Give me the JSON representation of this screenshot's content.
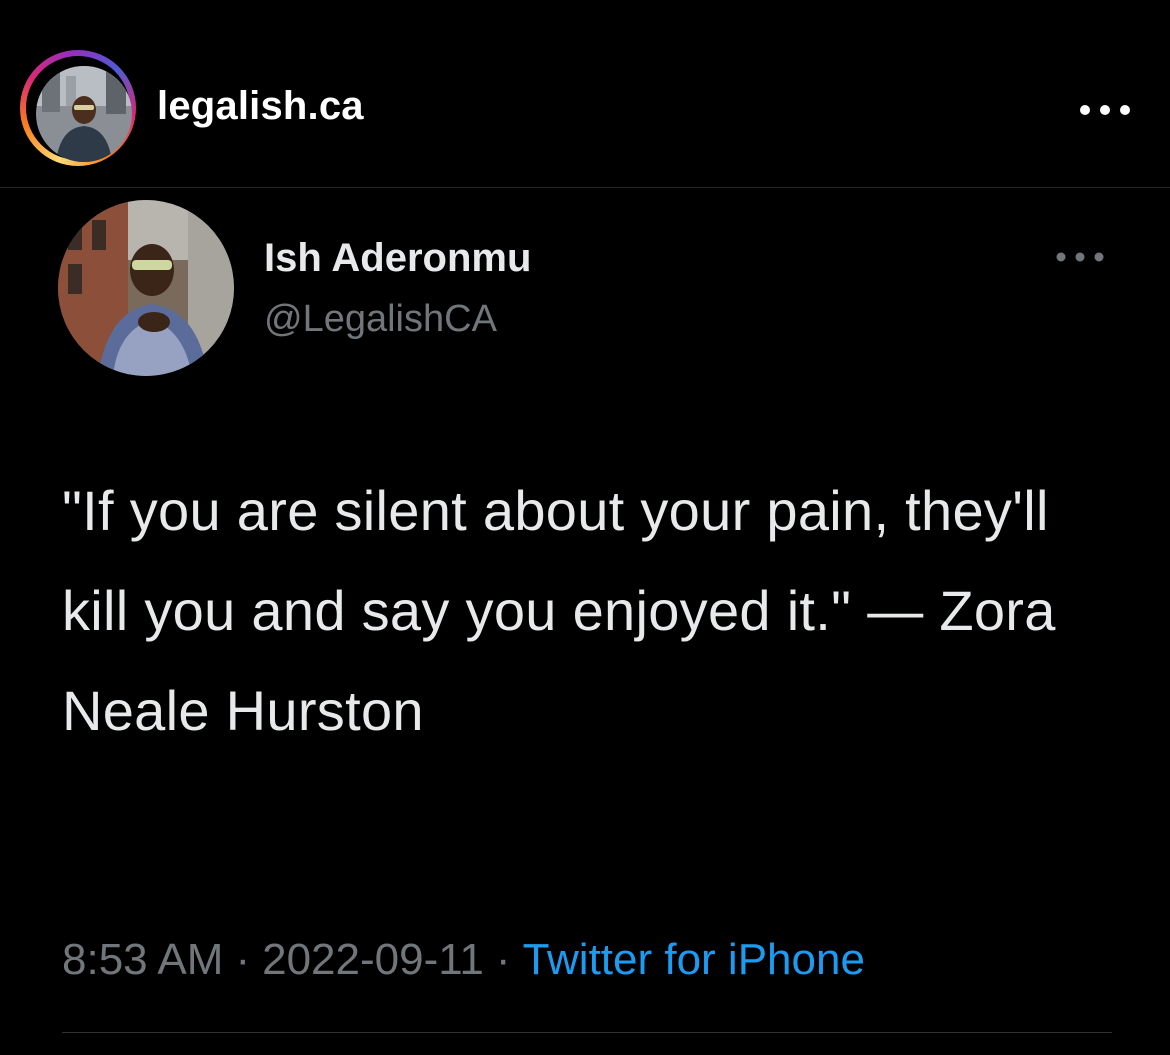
{
  "post": {
    "account_name": "legalish.ca",
    "more_icon": "more-horizontal-icon",
    "avatar_icon": "profile-photo"
  },
  "tweet": {
    "author_name": "Ish Aderonmu",
    "author_handle": "@LegalishCA",
    "more_icon": "more-horizontal-icon",
    "text": "\"If you are silent about your pain, they'll kill you and say you enjoyed it.\" — Zora Neale Hurston",
    "time": "8:53 AM",
    "separator": "·",
    "date": "2022-09-11",
    "source": "Twitter for iPhone"
  },
  "colors": {
    "background": "#000000",
    "primary_text": "#e7e9ea",
    "secondary_text": "#71767b",
    "link": "#1d9bf0",
    "divider": "#2f3336"
  }
}
